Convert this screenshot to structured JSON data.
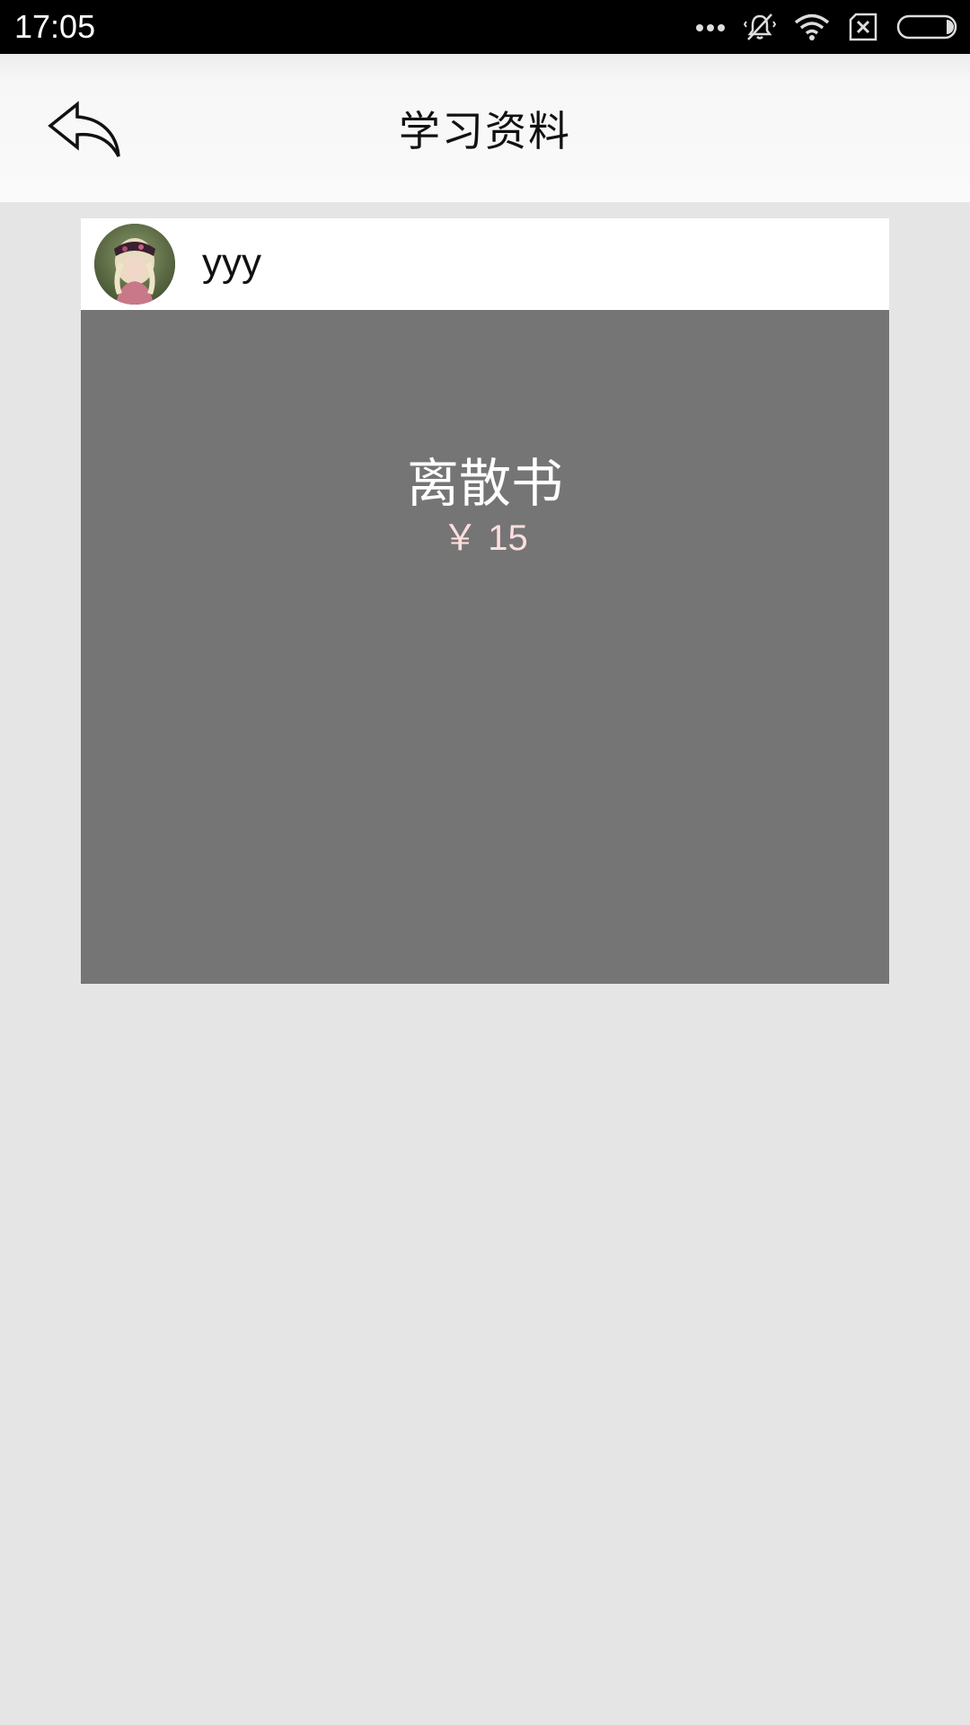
{
  "status_bar": {
    "time": "17:05",
    "icons": [
      "more-dots-icon",
      "vibrate-silent-icon",
      "wifi-icon",
      "no-sim-icon",
      "battery-icon"
    ]
  },
  "header": {
    "back_icon": "back-arrow-icon",
    "title": "学习资料"
  },
  "materials": [
    {
      "user": {
        "name": "yyy",
        "avatar": "user-avatar-photo"
      },
      "title": "离散书",
      "price": "￥ 15"
    }
  ],
  "colors": {
    "status_bar_bg": "#000000",
    "header_bg": "#fafafa",
    "page_bg": "#e5e5e5",
    "cover_bg": "#757575",
    "price_color": "#ffdede"
  }
}
